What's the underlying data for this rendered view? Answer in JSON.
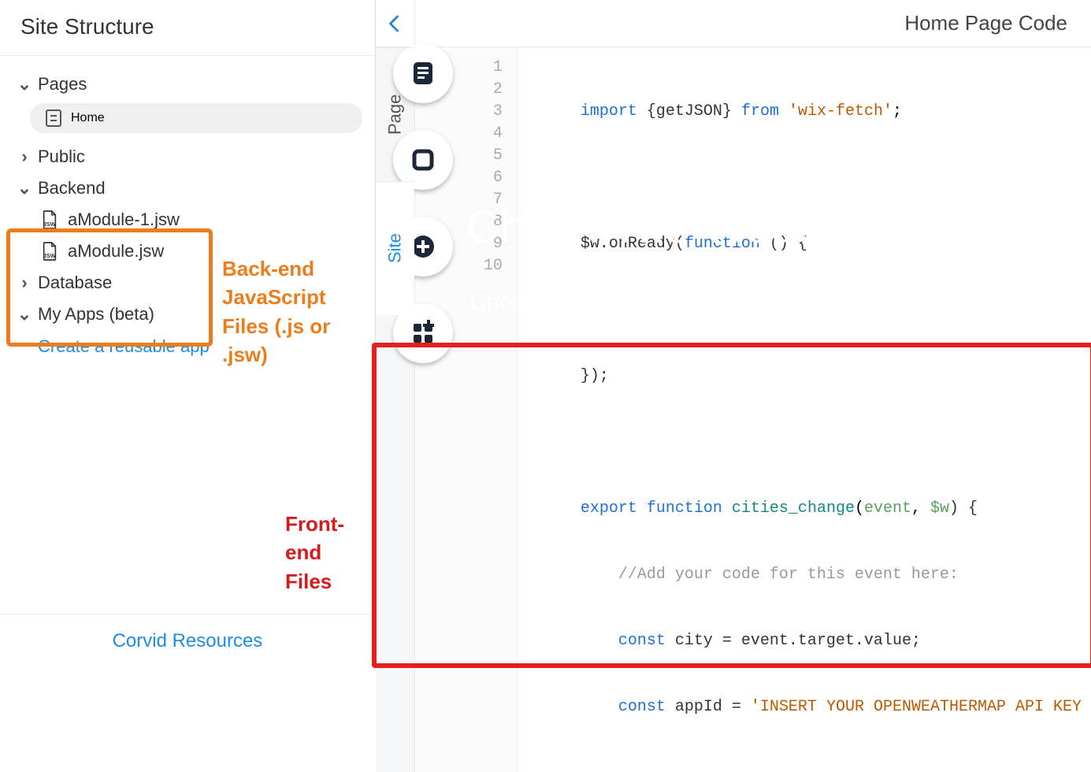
{
  "sidebar": {
    "title": "Site Structure",
    "pages": "Pages",
    "home": "Home",
    "public": "Public",
    "backend": "Backend",
    "backend_files": [
      "aModule-1.jsw",
      "aModule.jsw"
    ],
    "database": "Database",
    "myapps": "My Apps (beta)",
    "create_app": "Create a reusable app",
    "footer": "Corvid Resources"
  },
  "annotations": {
    "backend_line1": "Back-end",
    "backend_line2": "JavaScript",
    "backend_line3": "Files (.js or .jsw)",
    "frontend_line1": "Front-end",
    "frontend_line2": "Files"
  },
  "hero": {
    "title": "Check The Weather",
    "subtitle": "Check weather status in your favorite cities"
  },
  "code": {
    "title": "Home Page Code",
    "tabs": {
      "page": "Page",
      "site": "Site"
    },
    "line_numbers": [
      "1",
      "2",
      "3",
      "4",
      "5",
      "6",
      "7",
      "8",
      "9",
      "10"
    ],
    "l1": {
      "import": "import",
      "getjson": "{getJSON}",
      "from": "from",
      "str": "'wix-fetch'",
      "semi": ";"
    },
    "l3": {
      "pre": "$w.onReady(",
      "kw": "function",
      "post": " () {"
    },
    "l5": "});",
    "l7": {
      "export": "export",
      "function": "function",
      "name": "cities_change",
      "p1": "event",
      "comma": ", ",
      "p2": "$w",
      "close": ") {"
    },
    "l8": "    //Add your code for this event here:",
    "l9": {
      "indent": "    ",
      "const": "const",
      "rest": " city = event.target.value;"
    },
    "l10": {
      "indent": "    ",
      "const": "const",
      "mid": " appId = ",
      "str": "'INSERT YOUR OPENWEATHERMAP API KEY "
    }
  }
}
